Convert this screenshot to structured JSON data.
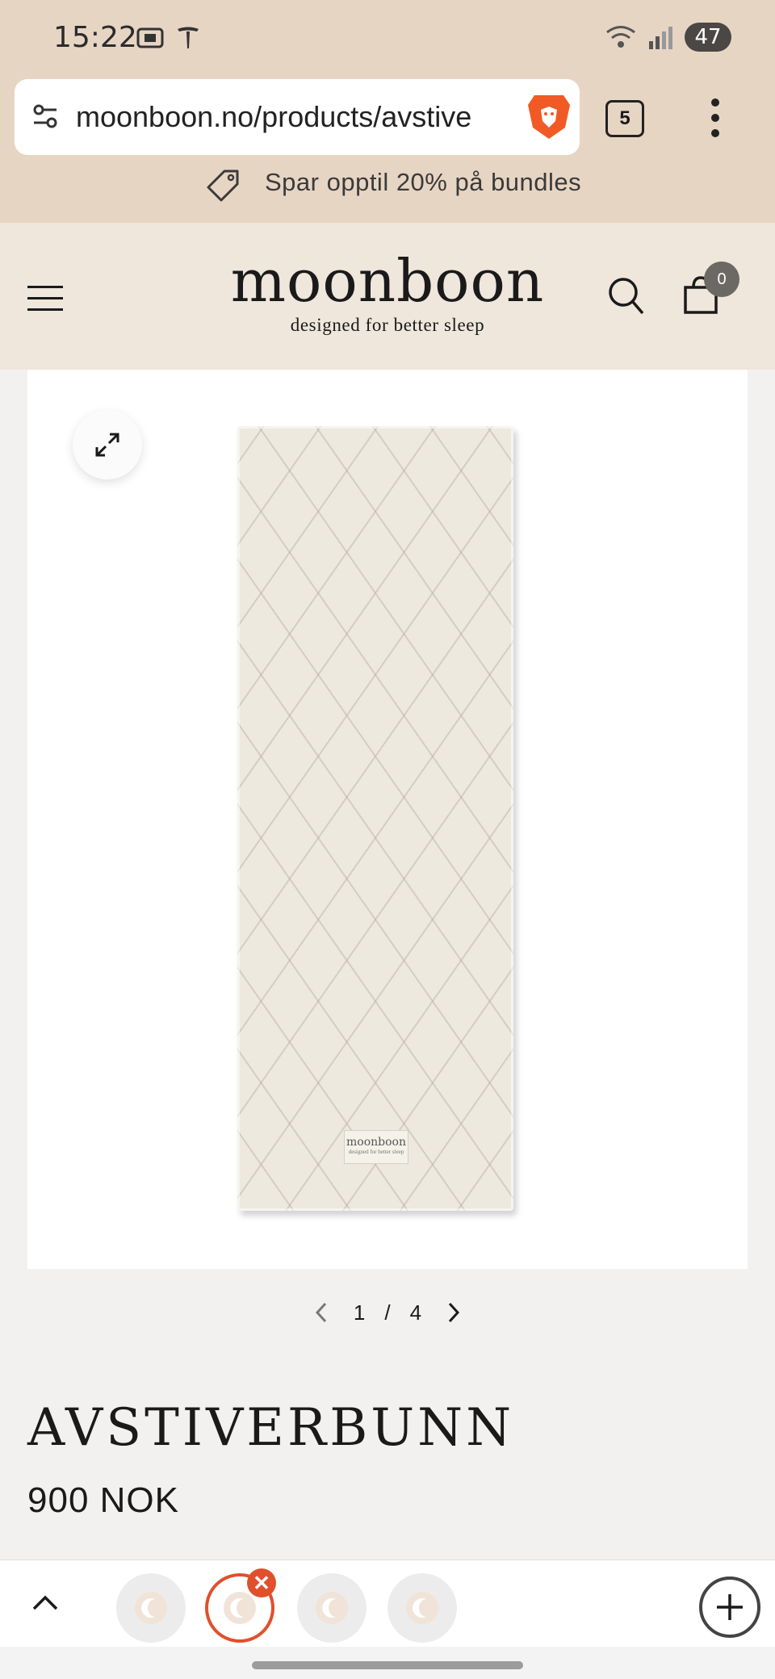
{
  "status_bar": {
    "time": "15:22",
    "battery": "47"
  },
  "browser": {
    "url": "moonboon.no/products/avstive",
    "tab_count": "5"
  },
  "promo": {
    "text": "Spar opptil 20% på bundles"
  },
  "header": {
    "logo": "moonboon",
    "tagline": "designed for better sleep",
    "cart_count": "0"
  },
  "product_image": {
    "label_name": "moonboon",
    "label_tagline": "designed for better sleep"
  },
  "gallery": {
    "current": "1",
    "separator": "/",
    "total": "4"
  },
  "product": {
    "title": "AVSTIVERBUNN",
    "price": "900 NOK"
  },
  "colors": {
    "accent": "#e0502c",
    "header_bg": "#efe6dc",
    "browser_bg": "#e7d5c3"
  },
  "toolbar": {
    "tab_icons": [
      "moonboon-favicon",
      "moonboon-favicon",
      "moonboon-favicon",
      "moonboon-favicon"
    ],
    "close_symbol": "✕"
  }
}
